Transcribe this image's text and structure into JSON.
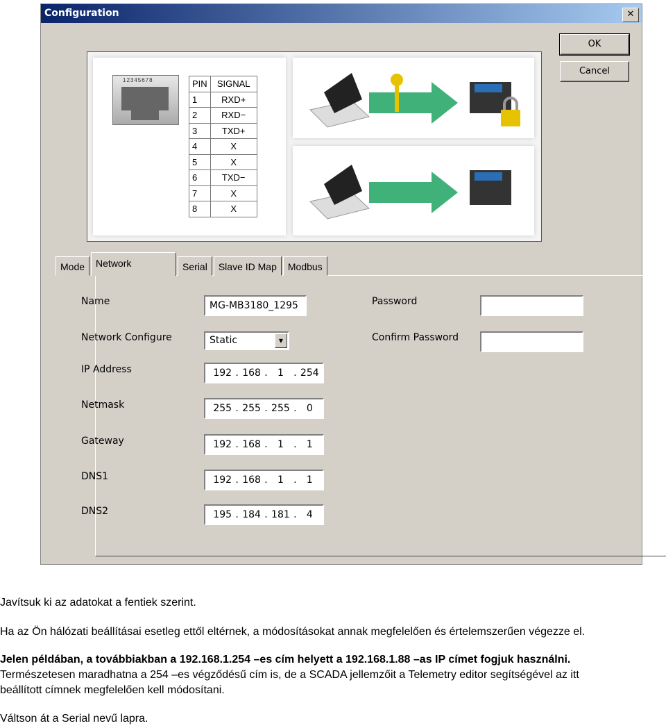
{
  "window": {
    "title": "Configuration",
    "close_glyph": "✕",
    "ok": "OK",
    "cancel": "Cancel"
  },
  "diagram": {
    "connector_pins": "12345678",
    "headers": [
      "PIN",
      "SIGNAL"
    ],
    "pins": [
      [
        "1",
        "RXD+"
      ],
      [
        "2",
        "RXD−"
      ],
      [
        "3",
        "TXD+"
      ],
      [
        "4",
        "X"
      ],
      [
        "5",
        "X"
      ],
      [
        "6",
        "TXD−"
      ],
      [
        "7",
        "X"
      ],
      [
        "8",
        "X"
      ]
    ]
  },
  "tabs": [
    "Mode",
    "Network",
    "Serial",
    "Slave ID Map",
    "Modbus"
  ],
  "active_tab": "Network",
  "form": {
    "name_label": "Name",
    "name_value": "MG-MB3180_1295",
    "netconf_label": "Network Configure",
    "netconf_value": "Static",
    "ip_label": "IP Address",
    "ip": [
      "192",
      "168",
      "1",
      "254"
    ],
    "netmask_label": "Netmask",
    "netmask": [
      "255",
      "255",
      "255",
      "0"
    ],
    "gateway_label": "Gateway",
    "gateway": [
      "192",
      "168",
      "1",
      "1"
    ],
    "dns1_label": "DNS1",
    "dns1": [
      "192",
      "168",
      "1",
      "1"
    ],
    "dns2_label": "DNS2",
    "dns2": [
      "195",
      "184",
      "181",
      "4"
    ],
    "password_label": "Password",
    "password_value": "",
    "confirm_label": "Confirm Password",
    "confirm_value": ""
  },
  "doc": {
    "p1": "Javítsuk ki az adatokat a fentiek szerint.",
    "p2": "Ha az Ön hálózati beállításai esetleg ettől eltérnek, a módosításokat annak megfelelően és értelemszerűen végezze el.",
    "p3_bold": "Jelen példában, a továbbiakban a 192.168.1.254 –es cím helyett a 192.168.1.88 –as IP címet fogjuk használni.",
    "p3_l2": "Természetesen maradhatna a 254 –es végződésű cím is, de a SCADA jellemzőit a Telemetry editor segítségével az itt",
    "p3_l3": "beállított címnek megfelelően kell módosítani.",
    "p4": "Váltson át a Serial nevű lapra."
  }
}
